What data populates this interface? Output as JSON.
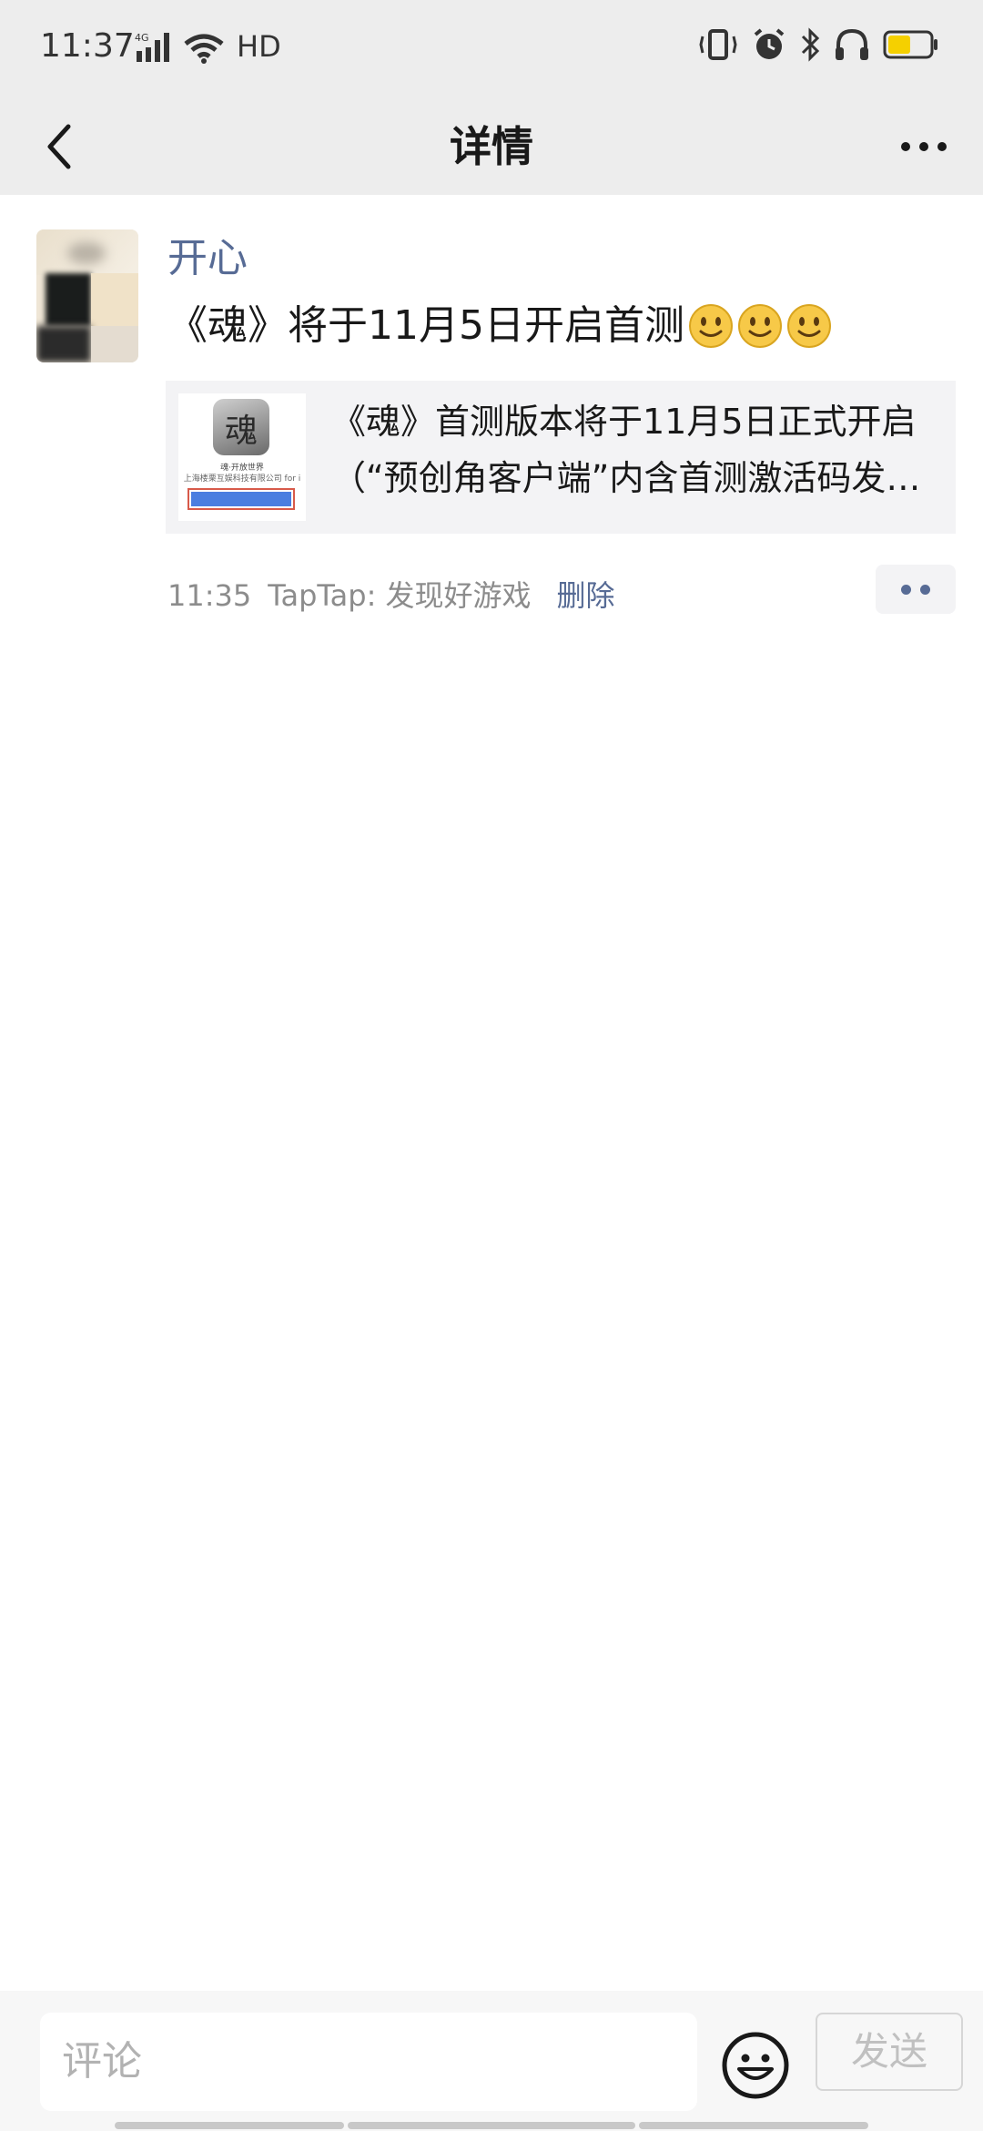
{
  "status_bar": {
    "time": "11:37",
    "network": "4G",
    "hd": "HD",
    "icons": [
      "signal-icon",
      "wifi-icon",
      "vibrate-icon",
      "alarm-icon",
      "bluetooth-icon",
      "headphones-icon",
      "battery-icon"
    ],
    "battery_color": "#f5d000"
  },
  "header": {
    "title": "详情",
    "back_icon": "chevron-left-icon",
    "more_icon": "more-horizontal-icon"
  },
  "post": {
    "username": "开心",
    "text": "《魂》将于11月5日开启首测",
    "emoji_count": 3,
    "emoji_name": "smile-emoji",
    "link_card": {
      "title_line1": "《魂》首测版本将于11月5日正式开启",
      "title_line2": "（“预创角客户端”内含首测激活码发放...",
      "thumb_logo": "魂",
      "thumb_line1": "魂·开放世界",
      "thumb_line2": "上海楼栗互娱科技有限公司 for i"
    },
    "time": "11:35",
    "source": "TapTap: 发现好游戏",
    "delete_label": "删除"
  },
  "comment_bar": {
    "placeholder": "评论",
    "send_label": "发送",
    "emoji_icon": "smiley-face-icon"
  },
  "colors": {
    "link_blue": "#576b95",
    "header_bg": "#ededed"
  }
}
